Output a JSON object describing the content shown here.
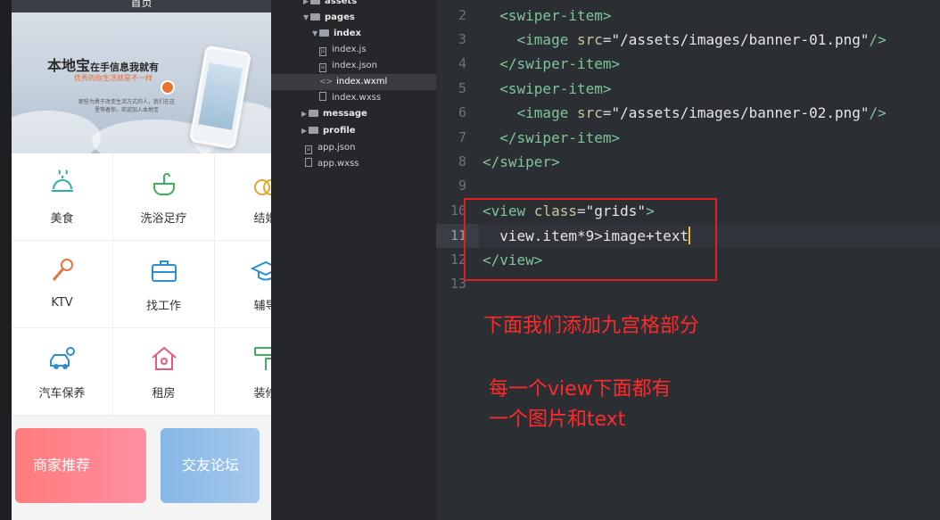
{
  "phone": {
    "navbar_title": "首页",
    "banner": {
      "title": "本地宝",
      "title_suffix": "在手信息我就有",
      "subtitle": "优秀的你生活就是不一样",
      "desc": "那些为勇于改变生活方式的人，我们在这里等着你，欢迎加入本地宝"
    },
    "grid_items": [
      {
        "label": "美食",
        "icon": "food-icon",
        "color": "#2bb0a8"
      },
      {
        "label": "洗浴足疗",
        "icon": "bath-icon",
        "color": "#3cae5c"
      },
      {
        "label": "结婚",
        "icon": "rings-icon",
        "color": "#e8a52c"
      },
      {
        "label": "KTV",
        "icon": "microphone-icon",
        "color": "#e8733c"
      },
      {
        "label": "找工作",
        "icon": "briefcase-icon",
        "color": "#2b8fd6"
      },
      {
        "label": "辅导",
        "icon": "graduation-cap-icon",
        "color": "#2b8fd6"
      },
      {
        "label": "汽车保养",
        "icon": "car-service-icon",
        "color": "#2b8fd6"
      },
      {
        "label": "租房",
        "icon": "house-icon",
        "color": "#e85a7c"
      },
      {
        "label": "装修",
        "icon": "paint-roller-icon",
        "color": "#3cae5c"
      }
    ],
    "promos": [
      {
        "label": "商家推荐"
      },
      {
        "label": "交友论坛"
      }
    ]
  },
  "file_tree": [
    {
      "label": "assets",
      "type": "folder",
      "indent": 1
    },
    {
      "label": "pages",
      "type": "folder",
      "indent": 1,
      "open": true
    },
    {
      "label": "index",
      "type": "folder",
      "indent": 2,
      "open": true
    },
    {
      "label": "index.js",
      "type": "file",
      "indent": 3
    },
    {
      "label": "index.json",
      "type": "file",
      "indent": 3
    },
    {
      "label": "index.wxml",
      "type": "file",
      "indent": 3,
      "selected": true
    },
    {
      "label": "index.wxss",
      "type": "file",
      "indent": 3
    },
    {
      "label": "message",
      "type": "folder",
      "indent": 2
    },
    {
      "label": "profile",
      "type": "folder",
      "indent": 2
    },
    {
      "label": "app.json",
      "type": "file",
      "indent": 1
    },
    {
      "label": "app.wxss",
      "type": "file",
      "indent": 1
    }
  ],
  "editor": {
    "lines": [
      {
        "n": "2",
        "text": "  <swiper-item>"
      },
      {
        "n": "3",
        "text": "    <image src=\"/assets/images/banner-01.png\"/>"
      },
      {
        "n": "4",
        "text": "  </swiper-item>"
      },
      {
        "n": "5",
        "text": "  <swiper-item>"
      },
      {
        "n": "6",
        "text": "    <image src=\"/assets/images/banner-02.png\"/>"
      },
      {
        "n": "7",
        "text": "  </swiper-item>"
      },
      {
        "n": "8",
        "text": "</swiper>"
      },
      {
        "n": "9",
        "text": ""
      },
      {
        "n": "10",
        "text": "<view class=\"grids\">"
      },
      {
        "n": "11",
        "text": "  view.item*9>image+text"
      },
      {
        "n": "12",
        "text": "</view>"
      },
      {
        "n": "13",
        "text": ""
      }
    ],
    "current_line": "11"
  },
  "annotations": {
    "note1": "下面我们添加九宫格部分",
    "note2_line1": "每一个view下面都有",
    "note2_line2": "一个图片和text",
    "highlight_color": "#e02020"
  }
}
